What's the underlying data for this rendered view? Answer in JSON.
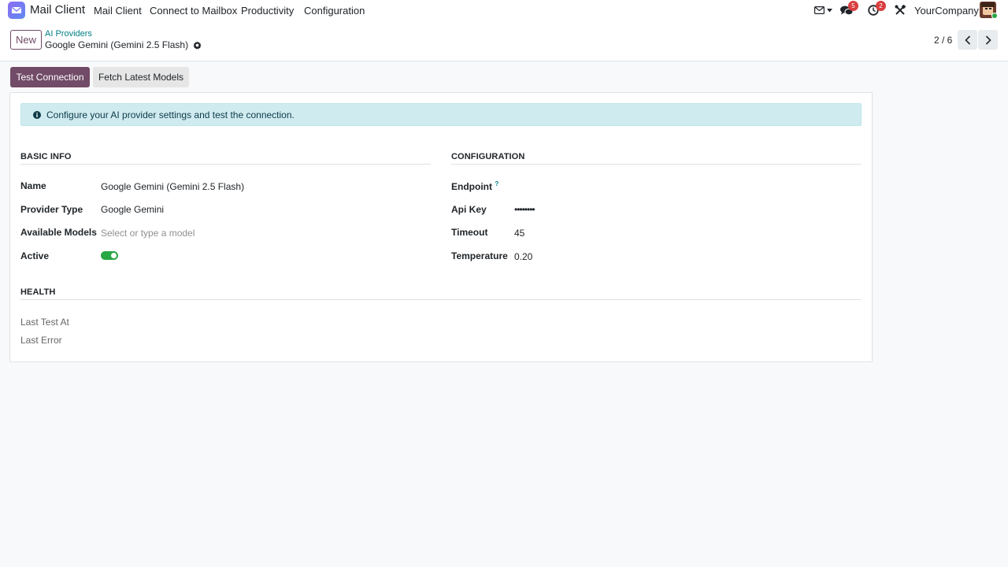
{
  "colors": {
    "brand": "#714b67",
    "link": "#017e84",
    "badge": "#d93f3f",
    "toggle_on": "#28a745",
    "alert_bg": "#d0ebf0"
  },
  "navbar": {
    "app_name": "Mail Client",
    "menu": [
      "Mail Client",
      "Connect to Mailbox",
      "Productivity",
      "Configuration"
    ],
    "messages_badge": "5",
    "activities_badge": "2",
    "company": "YourCompany",
    "icons": [
      "envelope-icon",
      "chat-bubbles-icon",
      "clock-icon",
      "tools-icon"
    ]
  },
  "control_panel": {
    "new_label": "New",
    "breadcrumb": "AI Providers",
    "record_title": "Google Gemini (Gemini 2.5 Flash)",
    "pager": "2 / 6"
  },
  "actions": {
    "test_connection": "Test Connection",
    "fetch_models": "Fetch Latest Models"
  },
  "alert_text": "Configure your AI provider settings and test the connection.",
  "basic_info": {
    "title": "BASIC INFO",
    "name_label": "Name",
    "name_value": "Google Gemini (Gemini 2.5 Flash)",
    "provider_type_label": "Provider Type",
    "provider_type_value": "Google Gemini",
    "available_models_label": "Available Models",
    "available_models_placeholder": "Select or type a model",
    "active_label": "Active",
    "active_value": true
  },
  "configuration": {
    "title": "CONFIGURATION",
    "endpoint_label": "Endpoint",
    "endpoint_help": "?",
    "api_key_label": "Api Key",
    "api_key_value": "••••••••",
    "timeout_label": "Timeout",
    "timeout_value": "45",
    "temperature_label": "Temperature",
    "temperature_value": "0.20"
  },
  "health": {
    "title": "HEALTH",
    "last_test_label": "Last Test At",
    "last_error_label": "Last Error"
  }
}
